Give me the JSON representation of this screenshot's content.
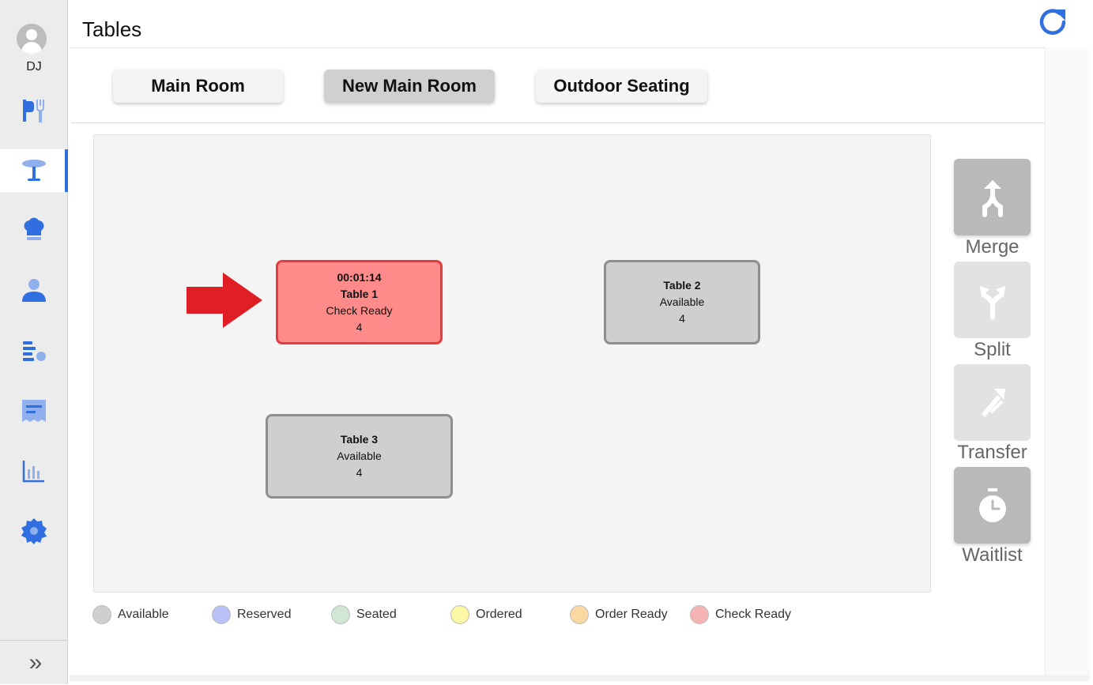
{
  "user": {
    "initials": "DJ"
  },
  "sidebar": {
    "items": [
      {
        "name": "menu",
        "icon": "menu-flag-fork-icon"
      },
      {
        "name": "tables",
        "icon": "table-icon",
        "active": true
      },
      {
        "name": "kitchen",
        "icon": "chef-hat-icon"
      },
      {
        "name": "customers",
        "icon": "person-icon"
      },
      {
        "name": "orders",
        "icon": "orders-list-icon"
      },
      {
        "name": "receipts",
        "icon": "receipt-icon"
      },
      {
        "name": "reports",
        "icon": "bar-chart-icon"
      },
      {
        "name": "settings",
        "icon": "gear-icon"
      }
    ],
    "expand_label": "»"
  },
  "header": {
    "title": "Tables",
    "refresh_icon": "refresh-icon"
  },
  "rooms": [
    {
      "label": "Main Room",
      "active": false
    },
    {
      "label": "New Main Room",
      "active": true
    },
    {
      "label": "Outdoor Seating",
      "active": false
    }
  ],
  "tables": [
    {
      "timer": "00:01:14",
      "name": "Table 1",
      "status": "Check Ready",
      "seats": "4",
      "color": "#ff8a8a"
    },
    {
      "name": "Table 2",
      "status": "Available",
      "seats": "4",
      "color": "#cfcfcf"
    },
    {
      "name": "Table 3",
      "status": "Available",
      "seats": "4",
      "color": "#cfcfcf"
    }
  ],
  "actions": [
    {
      "label": "Merge",
      "icon": "merge-icon",
      "enabled": true
    },
    {
      "label": "Split",
      "icon": "split-icon",
      "enabled": false
    },
    {
      "label": "Transfer",
      "icon": "transfer-icon",
      "enabled": false
    },
    {
      "label": "Waitlist",
      "icon": "timer-icon",
      "enabled": true
    }
  ],
  "legend": [
    {
      "label": "Available",
      "color": "#cfcfcf"
    },
    {
      "label": "Reserved",
      "color": "#b8c2f7"
    },
    {
      "label": "Seated",
      "color": "#cfe8d3"
    },
    {
      "label": "Ordered",
      "color": "#fbf7a4"
    },
    {
      "label": "Order Ready",
      "color": "#fbd7a2"
    },
    {
      "label": "Check Ready",
      "color": "#f6b3b3"
    }
  ],
  "colors": {
    "accent": "#2f6fdf",
    "accent_light": "#8fb0ec",
    "arrow": "#e01e26"
  }
}
